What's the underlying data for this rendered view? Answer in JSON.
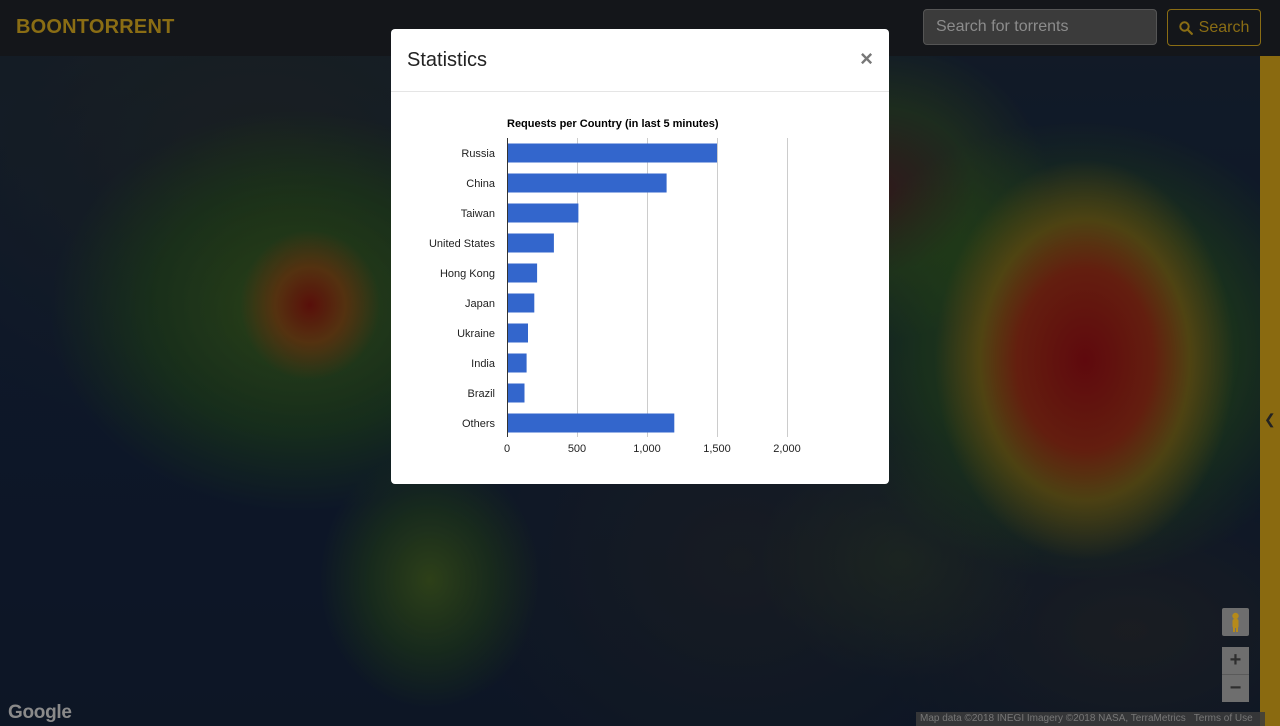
{
  "navbar": {
    "brand": "BOONTORRENT",
    "search_placeholder": "Search for torrents",
    "search_button_label": "Search"
  },
  "modal": {
    "title": "Statistics",
    "close_label": "×"
  },
  "map": {
    "logo": "Google",
    "attribution": [
      "Map data ©2018 INEGI Imagery ©2018 NASA, TerraMetrics",
      "Terms of Use"
    ],
    "zoom_in_label": "+",
    "zoom_out_label": "−"
  },
  "colors": {
    "brand": "#8a6d14",
    "bar": "#3366cc"
  },
  "chart_data": {
    "type": "bar",
    "orientation": "horizontal",
    "title": "Requests per Country (in last 5 minutes)",
    "categories": [
      "Russia",
      "China",
      "Taiwan",
      "United States",
      "Hong Kong",
      "Japan",
      "Ukraine",
      "India",
      "Brazil",
      "Others"
    ],
    "values": [
      1500,
      1140,
      510,
      335,
      215,
      195,
      150,
      140,
      125,
      1195
    ],
    "xlim": [
      0,
      2000
    ],
    "xticks": [
      0,
      500,
      1000,
      1500,
      2000
    ],
    "xtick_labels": [
      "0",
      "500",
      "1,000",
      "1,500",
      "2,000"
    ],
    "grid": true,
    "legend": "none"
  }
}
